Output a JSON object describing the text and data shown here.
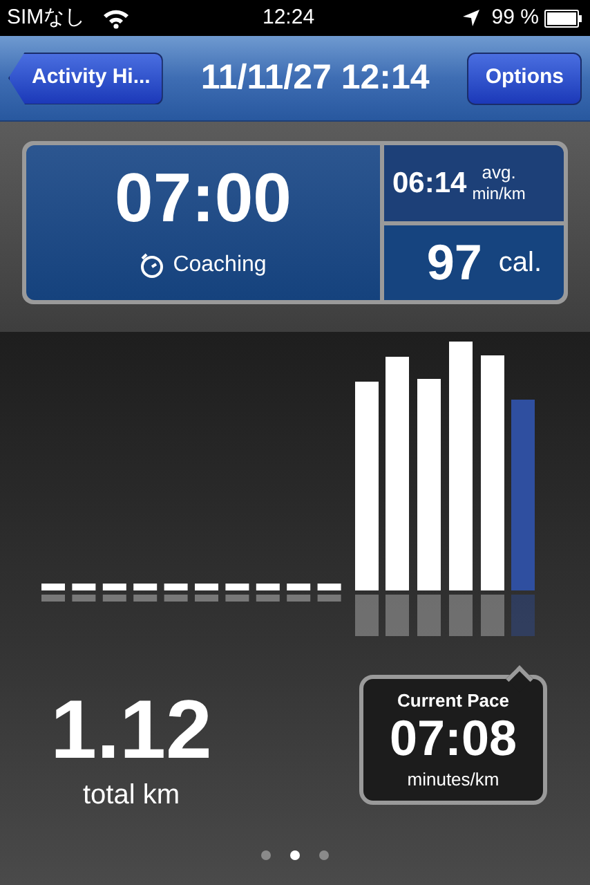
{
  "status_bar": {
    "carrier": "SIMなし",
    "time": "12:24",
    "battery": "99 %"
  },
  "nav_bar": {
    "back": "Activity Hi...",
    "title": "11/11/27 12:14",
    "action": "Options"
  },
  "summary": {
    "duration": "07:00",
    "mode": "Coaching",
    "avg_pace": "06:14",
    "avg_label_1": "avg.",
    "avg_label_2": "min/km",
    "calories": "97",
    "calories_unit": "cal."
  },
  "distance": {
    "value": "1.12",
    "unit": "total km"
  },
  "current_pace": {
    "label": "Current Pace",
    "value": "07:08",
    "unit": "minutes/km"
  },
  "page_dots": [
    {
      "selected": false
    },
    {
      "selected": true
    },
    {
      "selected": false
    }
  ]
}
